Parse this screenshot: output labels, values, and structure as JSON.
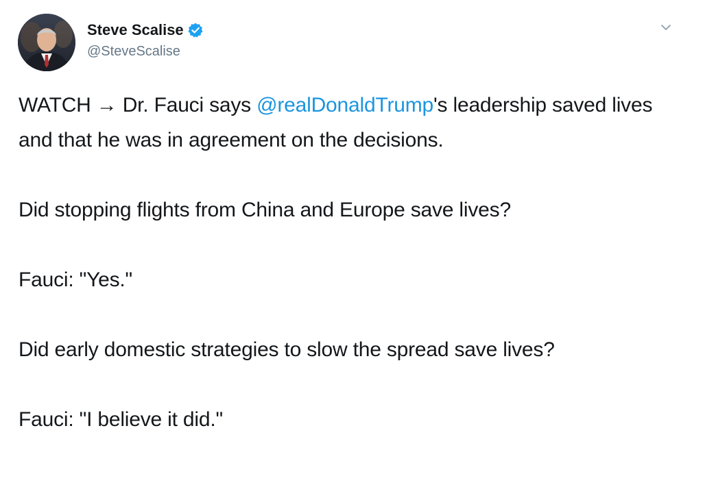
{
  "tweet": {
    "author": {
      "name": "Steve Scalise",
      "handle": "@SteveScalise",
      "verified": true
    },
    "paragraphs": [
      {
        "before": "WATCH → Dr. Fauci says ",
        "mention": "@realDonaldTrump",
        "after": "'s leadership saved lives and that he was in agreement on the decisions."
      },
      {
        "text": "Did stopping flights from China and Europe save lives?"
      },
      {
        "text": "Fauci: \"Yes.\""
      },
      {
        "text": "Did early domestic strategies to slow the spread save lives?"
      },
      {
        "text": "Fauci: \"I believe it did.\""
      }
    ]
  },
  "colors": {
    "text": "#14171a",
    "secondary": "#657786",
    "link": "#1b95e0",
    "verified_badge": "#1da1f2"
  },
  "icons": {
    "verified": "verified-badge-icon",
    "more": "chevron-down-icon"
  }
}
